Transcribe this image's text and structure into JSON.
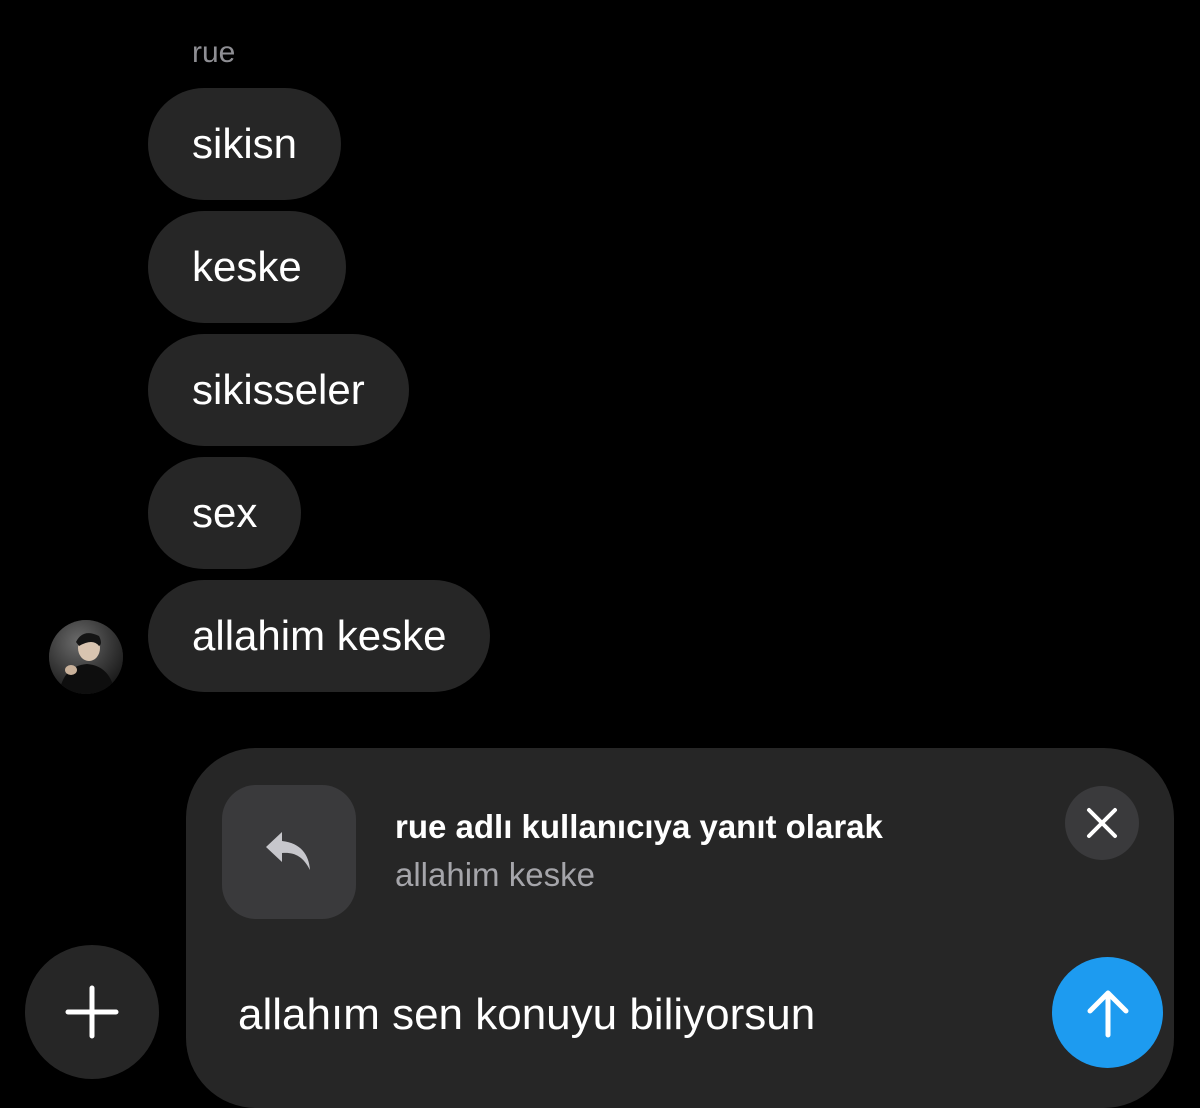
{
  "thread": {
    "sender_name": "rue",
    "messages": [
      {
        "text": "sikisn"
      },
      {
        "text": "keske"
      },
      {
        "text": "sikisseler"
      },
      {
        "text": "sex"
      },
      {
        "text": "allahim keske"
      }
    ]
  },
  "reply_preview": {
    "title": "rue adlı kullanıcıya yanıt olarak",
    "quoted_text": "allahim keske",
    "icon": "reply-arrow-icon",
    "close_icon": "close-icon"
  },
  "composer": {
    "input_value": "allahım sen konuyu biliyorsun",
    "send_icon": "arrow-up-icon",
    "add_icon": "plus-icon"
  },
  "colors": {
    "background": "#000000",
    "bubble": "#262626",
    "composer": "#262626",
    "send_button": "#1d9bf0",
    "muted_text": "#8e8e93"
  }
}
